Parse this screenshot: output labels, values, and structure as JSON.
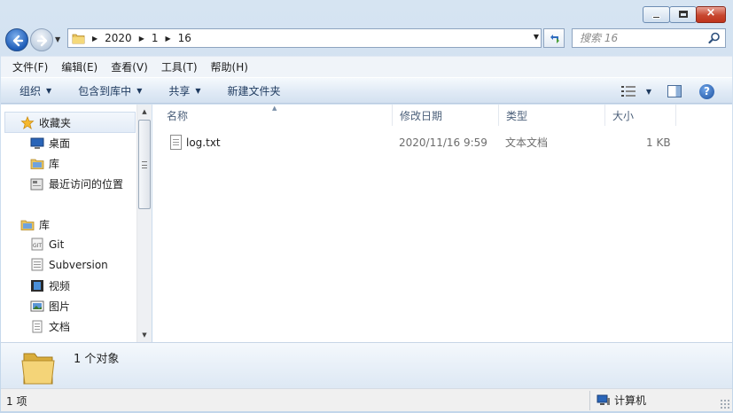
{
  "window": {
    "caption": {
      "minimize": "minimize",
      "maximize": "maximize",
      "close": "×"
    }
  },
  "address": {
    "crumbs": [
      "2020",
      "1",
      "16"
    ]
  },
  "search": {
    "placeholder": "搜索 16"
  },
  "menu": [
    "文件(F)",
    "编辑(E)",
    "查看(V)",
    "工具(T)",
    "帮助(H)"
  ],
  "toolbar": {
    "organize": "组织",
    "include_library": "包含到库中",
    "share": "共享",
    "new_folder": "新建文件夹",
    "help": "?"
  },
  "nav": {
    "favorites": "收藏夹",
    "favorites_items": [
      "桌面",
      "库",
      "最近访问的位置"
    ],
    "libraries": "库",
    "library_items": [
      "Git",
      "Subversion",
      "视频",
      "图片",
      "文档"
    ]
  },
  "columns": [
    "名称",
    "修改日期",
    "类型",
    "大小"
  ],
  "files": [
    {
      "name": "log.txt",
      "modified": "2020/11/16 9:59",
      "type": "文本文档",
      "size": "1 KB"
    }
  ],
  "details": {
    "summary": "1 个对象"
  },
  "status": {
    "count": "1 项",
    "zone": "计算机"
  },
  "colors": {
    "frame": "#c2d6ea",
    "toolbar_text": "#1e3a5f",
    "header_text": "#4c607a"
  }
}
